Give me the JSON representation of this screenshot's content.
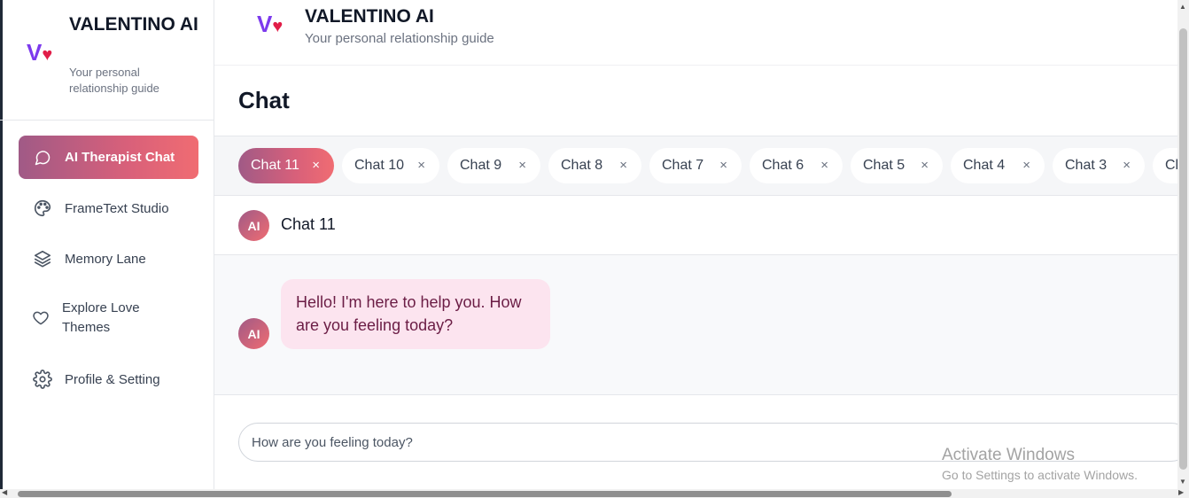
{
  "brand": {
    "logo_letter": "V",
    "logo_heart": "♥",
    "title": "VALENTINO AI",
    "subtitle": "Your personal relationship guide"
  },
  "sidebar": {
    "items": [
      {
        "label": "AI Therapist Chat",
        "icon": "chat-bubble-icon",
        "active": true
      },
      {
        "label": "FrameText Studio",
        "icon": "palette-icon",
        "active": false
      },
      {
        "label": "Memory Lane",
        "icon": "layers-icon",
        "active": false
      },
      {
        "label": "Explore Love Themes",
        "icon": "heart-icon",
        "active": false
      },
      {
        "label": "Profile & Setting",
        "icon": "gear-icon",
        "active": false
      }
    ]
  },
  "header": {
    "logo_letter": "V",
    "logo_heart": "♥",
    "title": "VALENTINO AI",
    "subtitle": "Your personal relationship guide"
  },
  "page": {
    "title": "Chat"
  },
  "tabs": [
    {
      "label": "Chat 11",
      "close": "×",
      "active": true
    },
    {
      "label": "Chat 10",
      "close": "×",
      "active": false
    },
    {
      "label": "Chat 9",
      "close": "×",
      "active": false
    },
    {
      "label": "Chat 8",
      "close": "×",
      "active": false
    },
    {
      "label": "Chat 7",
      "close": "×",
      "active": false
    },
    {
      "label": "Chat 6",
      "close": "×",
      "active": false
    },
    {
      "label": "Chat 5",
      "close": "×",
      "active": false
    },
    {
      "label": "Chat 4",
      "close": "×",
      "active": false
    },
    {
      "label": "Chat 3",
      "close": "×",
      "active": false
    },
    {
      "label": "Cl",
      "close": "",
      "active": false
    }
  ],
  "chat": {
    "avatar_text": "AI",
    "name": "Chat 11",
    "messages": [
      {
        "sender": "AI",
        "text": "Hello! I'm here to help you. How are you feeling today?"
      }
    ]
  },
  "composer": {
    "placeholder": "How are you feeling today?"
  },
  "watermark": {
    "title": "Activate Windows",
    "subtitle": "Go to Settings to activate Windows."
  },
  "colors": {
    "accent_gradient_start": "#a05a86",
    "accent_gradient_end": "#f06c72",
    "logo_v": "#7c3aed",
    "logo_heart": "#e11d48",
    "bubble_bg": "#fce4ef"
  }
}
